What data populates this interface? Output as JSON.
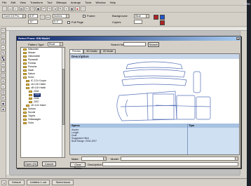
{
  "menu": [
    "File",
    "Edit",
    "View",
    "Transform",
    "Tool",
    "Bitmaps",
    "Arrange",
    "Tools",
    "Window",
    "Help"
  ],
  "toolbar1": [
    "new-icon",
    "open-icon",
    "save-icon",
    "print-icon",
    "cut-icon",
    "copy-icon",
    "paste-icon",
    "undo-icon",
    "redo-icon",
    "import-icon",
    "export-icon",
    "zoom-icon",
    "app-launcher-icon",
    "color-icon",
    "help-icon"
  ],
  "propbar": {
    "preset": "Corel 10 Pro",
    "width": "8.5\"",
    "height": "11\"",
    "units": "inches",
    "nudge": "0.1\"",
    "frame_label": "Frame",
    "full_page": "Full Page",
    "background_label": "Background:",
    "background_value": "Blue",
    "copies_label": "Copies"
  },
  "dialog": {
    "title": "Select From: Gift Model",
    "pattern_type_label": "Pattern Type",
    "pattern_type_value": "Boat",
    "search_label": "Search for:",
    "search_value": "",
    "search_button": "Search",
    "open_button": "Open (O)",
    "cancel_button": "Cancel",
    "clear_fields_button": "Clear Fields",
    "description_label": "Description",
    "make_label": "Make",
    "model_label": "Model",
    "tabs": [
      "Preview",
      "3D Details",
      "2D Model"
    ],
    "preview_header": "Description",
    "specs_header": "Specs",
    "tips_header": "Tips",
    "specs_lines": [
      "Airplex",
      "Length",
      "Draft",
      "Suggested Hitch",
      "Boat Range: 2004-2007"
    ]
  },
  "tree": [
    {
      "label": "Mitsubishi",
      "indent": 0,
      "open": false,
      "selected": false
    },
    {
      "label": "Nissan",
      "indent": 0,
      "open": false,
      "selected": false
    },
    {
      "label": "Oldsmobile",
      "indent": 0,
      "open": false,
      "selected": false
    },
    {
      "label": "Plymouth",
      "indent": 0,
      "open": false,
      "selected": false
    },
    {
      "label": "Pontiac",
      "indent": 0,
      "open": false,
      "selected": false
    },
    {
      "label": "Porsche",
      "indent": 0,
      "open": false,
      "selected": false
    },
    {
      "label": "Saab",
      "indent": 0,
      "open": false,
      "selected": false
    },
    {
      "label": "Saturn",
      "indent": 0,
      "open": false,
      "selected": false
    },
    {
      "label": "Scion",
      "indent": 0,
      "open": true,
      "selected": false
    },
    {
      "label": "tC 2-Dr Coupe",
      "indent": 1,
      "open": false,
      "selected": false
    },
    {
      "label": "xA 4-Dr Hatch",
      "indent": 1,
      "open": false,
      "selected": false
    },
    {
      "label": "xB 4-Dr Hatch",
      "indent": 1,
      "open": true,
      "selected": false
    },
    {
      "label": "2004",
      "indent": 2,
      "open": false,
      "selected": false
    },
    {
      "label": "2005",
      "indent": 2,
      "open": false,
      "selected": true
    },
    {
      "label": "2006",
      "indent": 2,
      "open": false,
      "selected": false
    },
    {
      "label": "2007",
      "indent": 2,
      "open": false,
      "selected": false
    },
    {
      "label": "xD 4-Dr Hatch",
      "indent": 1,
      "open": false,
      "selected": false
    },
    {
      "label": "Subaru",
      "indent": 0,
      "open": false,
      "selected": false
    },
    {
      "label": "Suzuki",
      "indent": 0,
      "open": false,
      "selected": false
    },
    {
      "label": "Toyota",
      "indent": 0,
      "open": false,
      "selected": false
    },
    {
      "label": "Volkswagen",
      "indent": 0,
      "open": false,
      "selected": false
    },
    {
      "label": "Volvo",
      "indent": 0,
      "open": false,
      "selected": false
    }
  ],
  "status": {
    "left_tab": "Default",
    "middle_tab": "Untitled-1.cdr",
    "right_tab": "Sketchbook"
  },
  "colors": {
    "titlebar": "#0a246a",
    "specs_bg": "#cfe0f3",
    "swatch1": "#b22222",
    "swatch2": "#2255cc"
  },
  "watermark": "PRO"
}
